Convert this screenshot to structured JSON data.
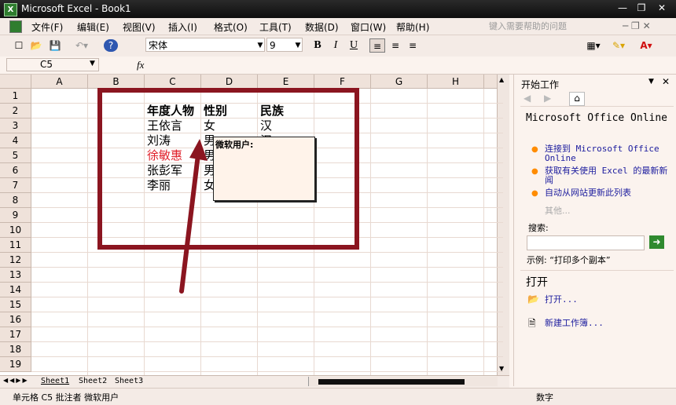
{
  "window": {
    "title": "Microsoft Excel - Book1",
    "app_icon": "X"
  },
  "menu": {
    "items": [
      "文件(F)",
      "编辑(E)",
      "视图(V)",
      "插入(I)",
      "格式(O)",
      "工具(T)",
      "数据(D)",
      "窗口(W)",
      "帮助(H)"
    ],
    "help_placeholder": "键入需要帮助的问题"
  },
  "toolbar": {
    "font_name": "宋体",
    "font_size": "9",
    "bold": "B",
    "italic": "I",
    "underline": "U",
    "fill_letter": "A"
  },
  "formula": {
    "name_box": "C5",
    "fx": "fx",
    "value": ""
  },
  "grid": {
    "columns": [
      "A",
      "B",
      "C",
      "D",
      "E",
      "F",
      "G",
      "H"
    ],
    "rows": [
      "1",
      "2",
      "3",
      "4",
      "5",
      "6",
      "7",
      "8",
      "9",
      "10",
      "11",
      "12",
      "13",
      "14",
      "15",
      "16",
      "17",
      "18",
      "19"
    ],
    "cells": {
      "C2": "年度人物",
      "D2": "性别",
      "E2": "民族",
      "C3": "王依言",
      "D3": "女",
      "E3": "汉",
      "C4": "刘涛",
      "D4": "男",
      "E4": "汉",
      "C5": "徐敏惠",
      "D5": "男",
      "C6": "张彭军",
      "D6": "男",
      "C7": "李丽",
      "D7": "女"
    },
    "comment_author": "微软用户:"
  },
  "sheets": {
    "tabs": [
      "Sheet1",
      "Sheet2",
      "Sheet3"
    ],
    "active": "Sheet1"
  },
  "status": {
    "left": "单元格 C5 批注者 微软用户",
    "right": "数字"
  },
  "taskpane": {
    "title": "开始工作",
    "online_heading": "Microsoft Office Online",
    "links": [
      "连接到 Microsoft Office Online",
      "获取有关使用 Excel 的最新新闻",
      "自动从网站更新此列表"
    ],
    "more": "其他...",
    "search_label": "搜索:",
    "example": "示例:  “打印多个副本”",
    "open_heading": "打开",
    "open_link": "打开...",
    "new_link": "新建工作簿..."
  },
  "colors": {
    "highlight_box": "#8b1520",
    "red_text": "#e0202a",
    "accent_orange": "#ff8c00"
  }
}
